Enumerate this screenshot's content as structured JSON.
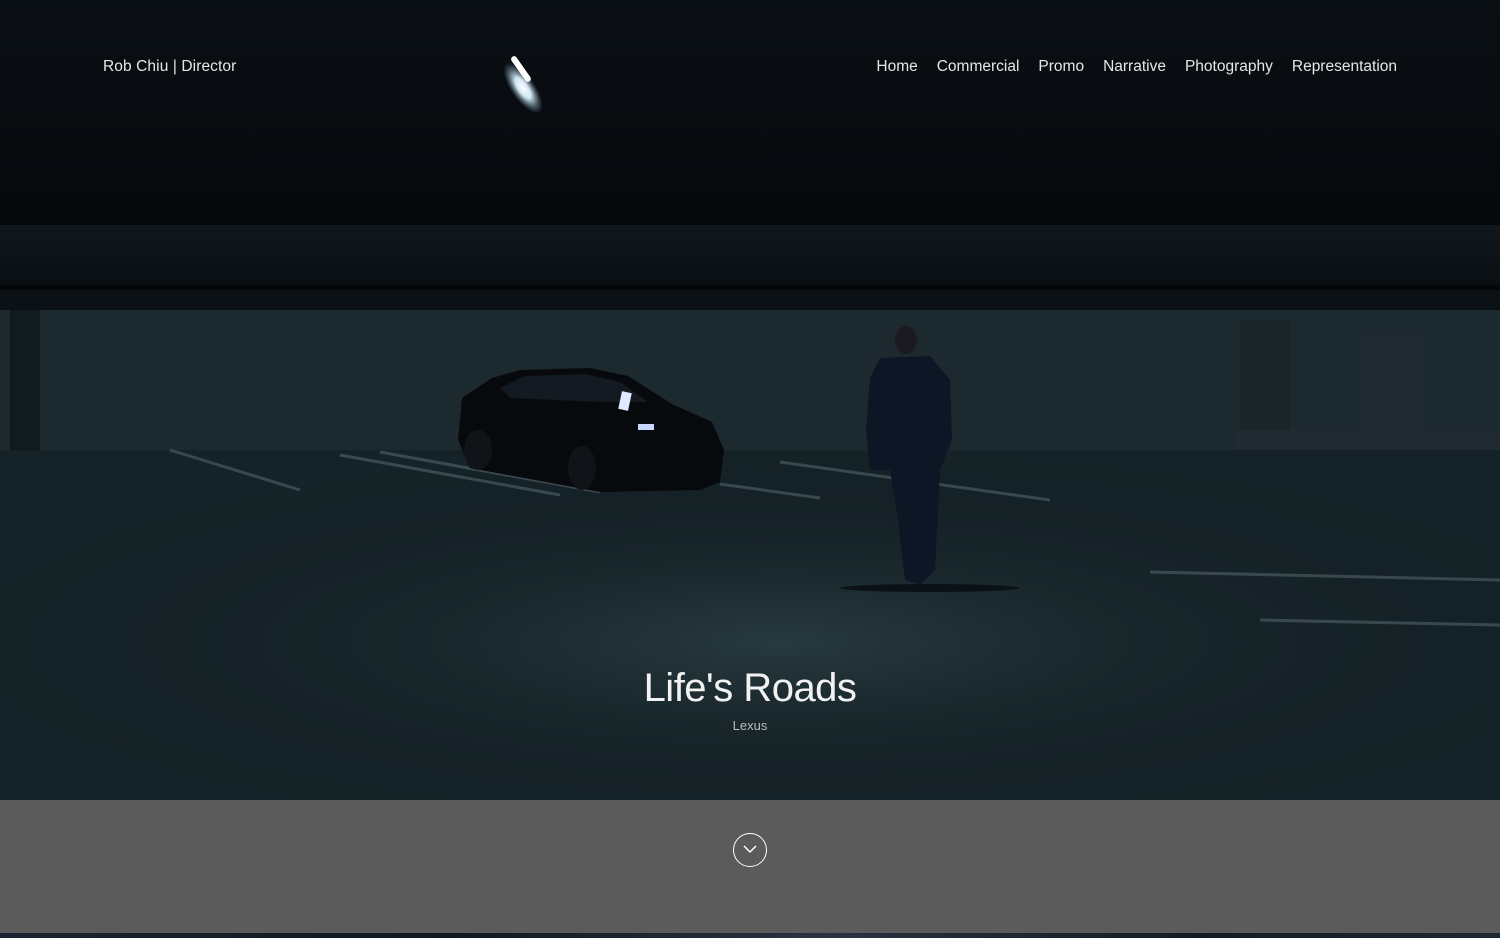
{
  "header": {
    "brand": "Rob Chiu | Director",
    "nav": [
      {
        "label": "Home"
      },
      {
        "label": "Commercial"
      },
      {
        "label": "Promo"
      },
      {
        "label": "Narrative"
      },
      {
        "label": "Photography"
      },
      {
        "label": "Representation"
      }
    ]
  },
  "hero": {
    "title": "Life's Roads",
    "client": "Lexus"
  },
  "scroll": {
    "icon": "chevron-down-circle-icon"
  },
  "colors": {
    "band": "#5b5b5b",
    "text": "#e6e6e6",
    "scene": "#17252a"
  }
}
